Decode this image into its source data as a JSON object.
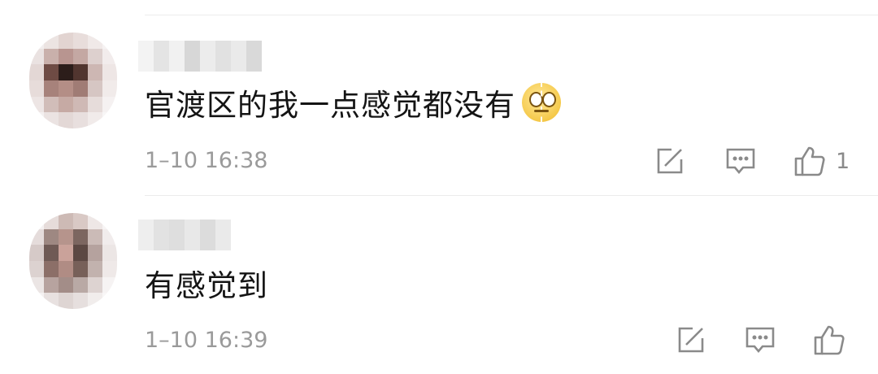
{
  "comments": [
    {
      "text": "官渡区的我一点感觉都没有",
      "emoji": "cracked-face-emoji",
      "time": "1–10 16:38",
      "like_count": "1"
    },
    {
      "text": "有感觉到",
      "time": "1–10 16:39",
      "like_count": ""
    }
  ],
  "colors": {
    "text": "#141414",
    "meta": "#9a9a9a",
    "icon": "#8a8a8a",
    "divider": "#ececec"
  }
}
